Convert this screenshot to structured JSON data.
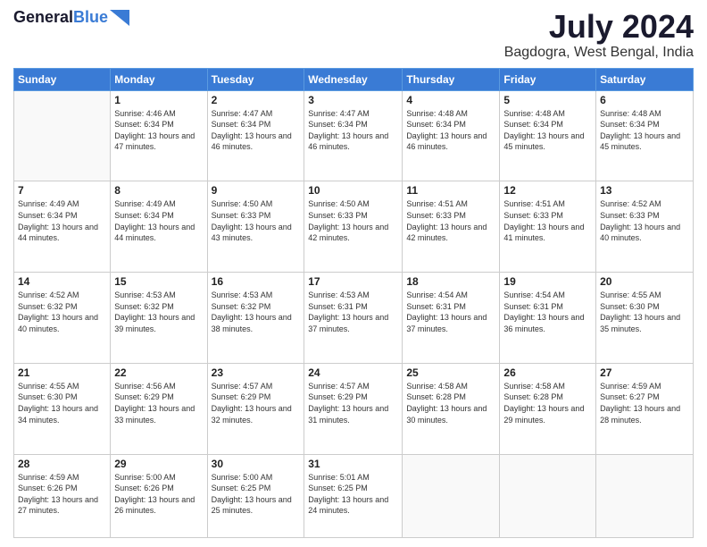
{
  "logo": {
    "line1": "General",
    "line2": "Blue"
  },
  "title": {
    "month_year": "July 2024",
    "location": "Bagdogra, West Bengal, India"
  },
  "headers": [
    "Sunday",
    "Monday",
    "Tuesday",
    "Wednesday",
    "Thursday",
    "Friday",
    "Saturday"
  ],
  "weeks": [
    [
      {
        "day": "",
        "sunrise": "",
        "sunset": "",
        "daylight": ""
      },
      {
        "day": "1",
        "sunrise": "4:46 AM",
        "sunset": "6:34 PM",
        "daylight": "13 hours and 47 minutes."
      },
      {
        "day": "2",
        "sunrise": "4:47 AM",
        "sunset": "6:34 PM",
        "daylight": "13 hours and 46 minutes."
      },
      {
        "day": "3",
        "sunrise": "4:47 AM",
        "sunset": "6:34 PM",
        "daylight": "13 hours and 46 minutes."
      },
      {
        "day": "4",
        "sunrise": "4:48 AM",
        "sunset": "6:34 PM",
        "daylight": "13 hours and 46 minutes."
      },
      {
        "day": "5",
        "sunrise": "4:48 AM",
        "sunset": "6:34 PM",
        "daylight": "13 hours and 45 minutes."
      },
      {
        "day": "6",
        "sunrise": "4:48 AM",
        "sunset": "6:34 PM",
        "daylight": "13 hours and 45 minutes."
      }
    ],
    [
      {
        "day": "7",
        "sunrise": "4:49 AM",
        "sunset": "6:34 PM",
        "daylight": "13 hours and 44 minutes."
      },
      {
        "day": "8",
        "sunrise": "4:49 AM",
        "sunset": "6:34 PM",
        "daylight": "13 hours and 44 minutes."
      },
      {
        "day": "9",
        "sunrise": "4:50 AM",
        "sunset": "6:33 PM",
        "daylight": "13 hours and 43 minutes."
      },
      {
        "day": "10",
        "sunrise": "4:50 AM",
        "sunset": "6:33 PM",
        "daylight": "13 hours and 42 minutes."
      },
      {
        "day": "11",
        "sunrise": "4:51 AM",
        "sunset": "6:33 PM",
        "daylight": "13 hours and 42 minutes."
      },
      {
        "day": "12",
        "sunrise": "4:51 AM",
        "sunset": "6:33 PM",
        "daylight": "13 hours and 41 minutes."
      },
      {
        "day": "13",
        "sunrise": "4:52 AM",
        "sunset": "6:33 PM",
        "daylight": "13 hours and 40 minutes."
      }
    ],
    [
      {
        "day": "14",
        "sunrise": "4:52 AM",
        "sunset": "6:32 PM",
        "daylight": "13 hours and 40 minutes."
      },
      {
        "day": "15",
        "sunrise": "4:53 AM",
        "sunset": "6:32 PM",
        "daylight": "13 hours and 39 minutes."
      },
      {
        "day": "16",
        "sunrise": "4:53 AM",
        "sunset": "6:32 PM",
        "daylight": "13 hours and 38 minutes."
      },
      {
        "day": "17",
        "sunrise": "4:53 AM",
        "sunset": "6:31 PM",
        "daylight": "13 hours and 37 minutes."
      },
      {
        "day": "18",
        "sunrise": "4:54 AM",
        "sunset": "6:31 PM",
        "daylight": "13 hours and 37 minutes."
      },
      {
        "day": "19",
        "sunrise": "4:54 AM",
        "sunset": "6:31 PM",
        "daylight": "13 hours and 36 minutes."
      },
      {
        "day": "20",
        "sunrise": "4:55 AM",
        "sunset": "6:30 PM",
        "daylight": "13 hours and 35 minutes."
      }
    ],
    [
      {
        "day": "21",
        "sunrise": "4:55 AM",
        "sunset": "6:30 PM",
        "daylight": "13 hours and 34 minutes."
      },
      {
        "day": "22",
        "sunrise": "4:56 AM",
        "sunset": "6:29 PM",
        "daylight": "13 hours and 33 minutes."
      },
      {
        "day": "23",
        "sunrise": "4:57 AM",
        "sunset": "6:29 PM",
        "daylight": "13 hours and 32 minutes."
      },
      {
        "day": "24",
        "sunrise": "4:57 AM",
        "sunset": "6:29 PM",
        "daylight": "13 hours and 31 minutes."
      },
      {
        "day": "25",
        "sunrise": "4:58 AM",
        "sunset": "6:28 PM",
        "daylight": "13 hours and 30 minutes."
      },
      {
        "day": "26",
        "sunrise": "4:58 AM",
        "sunset": "6:28 PM",
        "daylight": "13 hours and 29 minutes."
      },
      {
        "day": "27",
        "sunrise": "4:59 AM",
        "sunset": "6:27 PM",
        "daylight": "13 hours and 28 minutes."
      }
    ],
    [
      {
        "day": "28",
        "sunrise": "4:59 AM",
        "sunset": "6:26 PM",
        "daylight": "13 hours and 27 minutes."
      },
      {
        "day": "29",
        "sunrise": "5:00 AM",
        "sunset": "6:26 PM",
        "daylight": "13 hours and 26 minutes."
      },
      {
        "day": "30",
        "sunrise": "5:00 AM",
        "sunset": "6:25 PM",
        "daylight": "13 hours and 25 minutes."
      },
      {
        "day": "31",
        "sunrise": "5:01 AM",
        "sunset": "6:25 PM",
        "daylight": "13 hours and 24 minutes."
      },
      {
        "day": "",
        "sunrise": "",
        "sunset": "",
        "daylight": ""
      },
      {
        "day": "",
        "sunrise": "",
        "sunset": "",
        "daylight": ""
      },
      {
        "day": "",
        "sunrise": "",
        "sunset": "",
        "daylight": ""
      }
    ]
  ]
}
